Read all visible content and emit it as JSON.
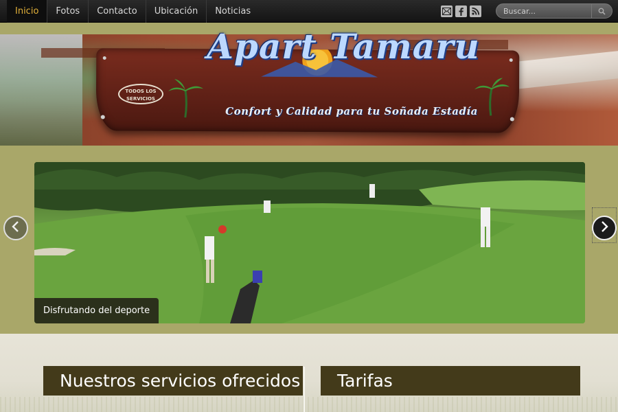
{
  "nav": {
    "items": [
      {
        "label": "Inicio",
        "active": true
      },
      {
        "label": "Fotos",
        "active": false
      },
      {
        "label": "Contacto",
        "active": false
      },
      {
        "label": "Ubicación",
        "active": false
      },
      {
        "label": "Noticias",
        "active": false
      }
    ]
  },
  "social": {
    "icons": [
      "mail-icon",
      "facebook-icon",
      "rss-icon"
    ]
  },
  "search": {
    "placeholder": "Buscar..."
  },
  "banner": {
    "title": "Apart Tamaru",
    "tagline": "Confort y Calidad para tu Soñada Estadía",
    "badge": "TODOS LOS SERVICIOS"
  },
  "slider": {
    "caption": "Disfrutando del deporte"
  },
  "sections": [
    {
      "title": "Nuestros servicios ofrecidos"
    },
    {
      "title": "Tarifas"
    }
  ],
  "colors": {
    "nav_active_text": "#e3b13a",
    "olive_background": "#a9a769",
    "section_title_bg": "#433a1a"
  }
}
